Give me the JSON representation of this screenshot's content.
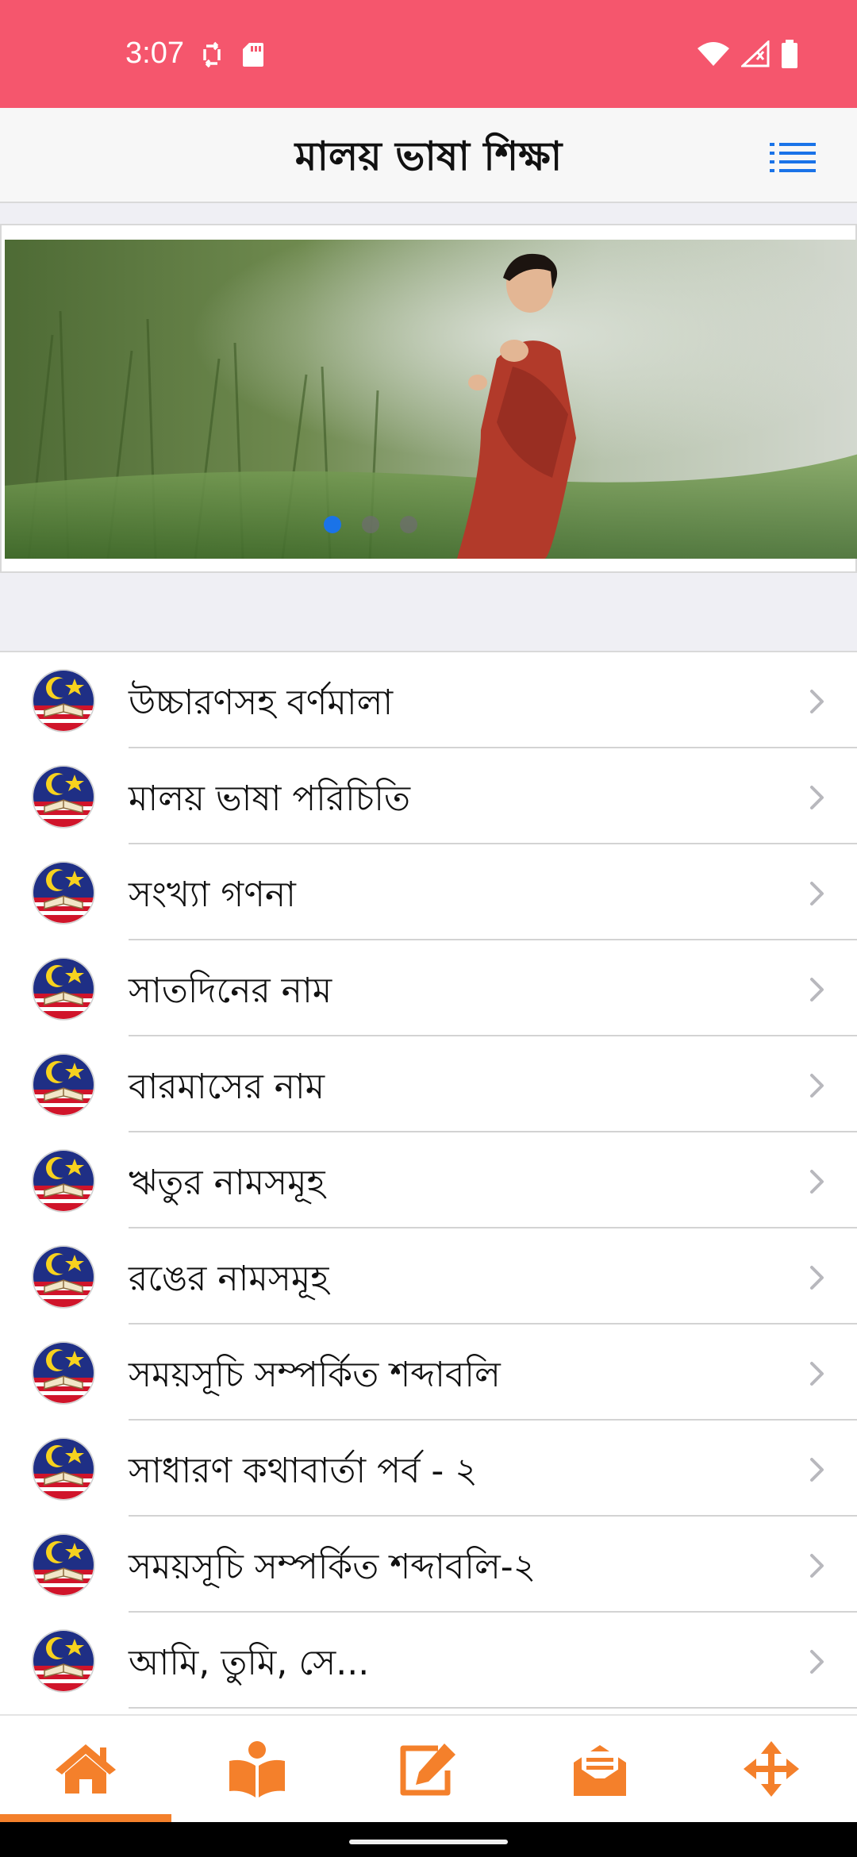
{
  "status_bar": {
    "time": "3:07",
    "left_icons": [
      "sync-icon",
      "sd-card-icon"
    ],
    "right_icons": [
      "wifi-icon",
      "cellular-signal-icon",
      "battery-icon"
    ],
    "background": "#f5566d"
  },
  "header": {
    "title": "মালয় ভাষা শিক্ষা",
    "menu_icon": "list-menu-icon",
    "accent": "#1a73e8"
  },
  "banner": {
    "slide_count": 3,
    "active_slide": 1
  },
  "list": {
    "items": [
      {
        "label": "উচ্চারণসহ বর্ণমালা"
      },
      {
        "label": "মালয় ভাষা পরিচিতি"
      },
      {
        "label": "সংখ্যা গণনা"
      },
      {
        "label": "সাতদিনের নাম"
      },
      {
        "label": "বারমাসের নাম"
      },
      {
        "label": "ঋতুর নামসমূহ"
      },
      {
        "label": "রঙের নামসমূহ"
      },
      {
        "label": "সময়সূচি সম্পর্কিত শব্দাবলি"
      },
      {
        "label": "সাধারণ কথাবার্তা পর্ব - ২"
      },
      {
        "label": "সময়সূচি সম্পর্কিত শব্দাবলি-২"
      },
      {
        "label": "আমি, তুমি, সে..."
      }
    ]
  },
  "tab_bar": {
    "tabs": [
      {
        "icon": "home-icon",
        "active": true
      },
      {
        "icon": "book-reader-icon",
        "active": false
      },
      {
        "icon": "edit-icon",
        "active": false
      },
      {
        "icon": "envelope-open-text-icon",
        "active": false
      },
      {
        "icon": "move-arrows-icon",
        "active": false
      }
    ],
    "accent": "#f4802b"
  }
}
